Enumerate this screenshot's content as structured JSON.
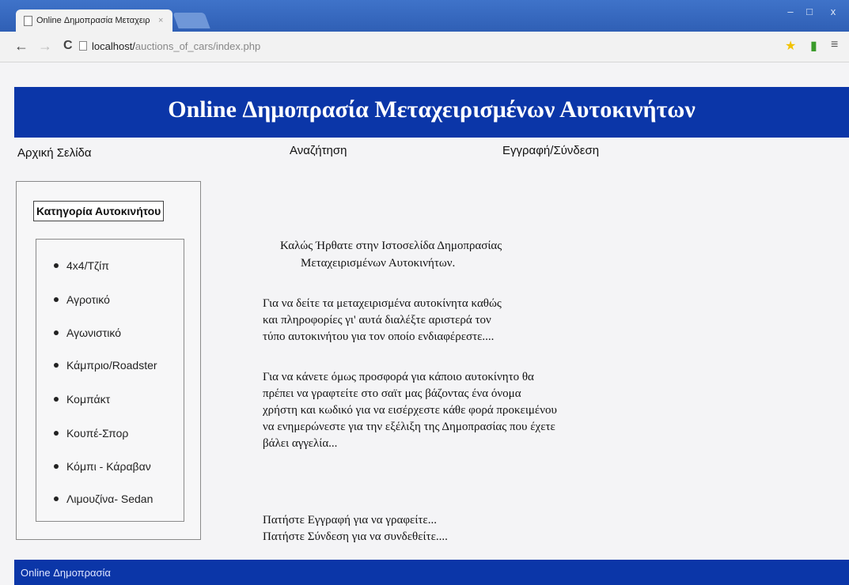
{
  "browser": {
    "tab_title": "Online Δημοπρασία Μεταχειρ",
    "tab_close": "×",
    "url_host": "localhost/",
    "url_path": "auctions_of_cars/index.php",
    "back_icon": "←",
    "forward_icon": "→",
    "reload_icon": "C",
    "star_icon": "★",
    "signal_icon": "▮",
    "menu_icon": "≡",
    "minimize": "–",
    "maximize": "□",
    "close": "x"
  },
  "header": {
    "title": "Online Δημοπρασία Μεταχειρισμένων Αυτοκινήτων"
  },
  "nav": {
    "home": "Αρχική Σελίδα",
    "search": "Αναζήτηση",
    "register": "Εγγραφή/Σύνδεση"
  },
  "sidebar": {
    "heading": "Κατηγορία Αυτοκινήτου",
    "categories": [
      "4x4/Τζίπ",
      "Αγροτικό",
      "Αγωνιστικό",
      "Κάμπριο/Roadster",
      "Κομπάκτ",
      "Κουπέ-Σπορ",
      "Κόμπι - Κάραβαν",
      "Λιμουζίνα- Sedan"
    ]
  },
  "main": {
    "welcome_line1": "Καλώς  Ήρθατε στην Ιστοσελίδα Δημοπρασίας",
    "welcome_line2": "Μεταχειρισμένων Αυτοκινήτων.",
    "para1": [
      "Για να δείτε τα μεταχειρισμένα αυτοκίνητα καθώς",
      "και πληροφορίες γι' αυτά διαλέξτε αριστερά τον",
      "τύπο αυτοκινήτου για τον οποίο ενδιαφέρεστε...."
    ],
    "para2": [
      "Για να κάνετε όμως προσφορά για κάποιο αυτοκίνητο θα",
      "πρέπει να γραφτείτε στο σαϊτ μας βάζοντας ένα όνομα",
      "χρήστη και κωδικό για να εισέρχεστε κάθε φορά προκειμένου",
      "να ενημερώνεστε για την εξέλιξη της Δημοπρασίας που έχετε",
      "βάλει αγγελία..."
    ],
    "para3": [
      "Πατήστε Εγγραφή για να γραφείτε...",
      "Πατήστε Σύνδεση για να συνδεθείτε...."
    ]
  },
  "footer": {
    "text": "Online Δημοπρασία"
  }
}
